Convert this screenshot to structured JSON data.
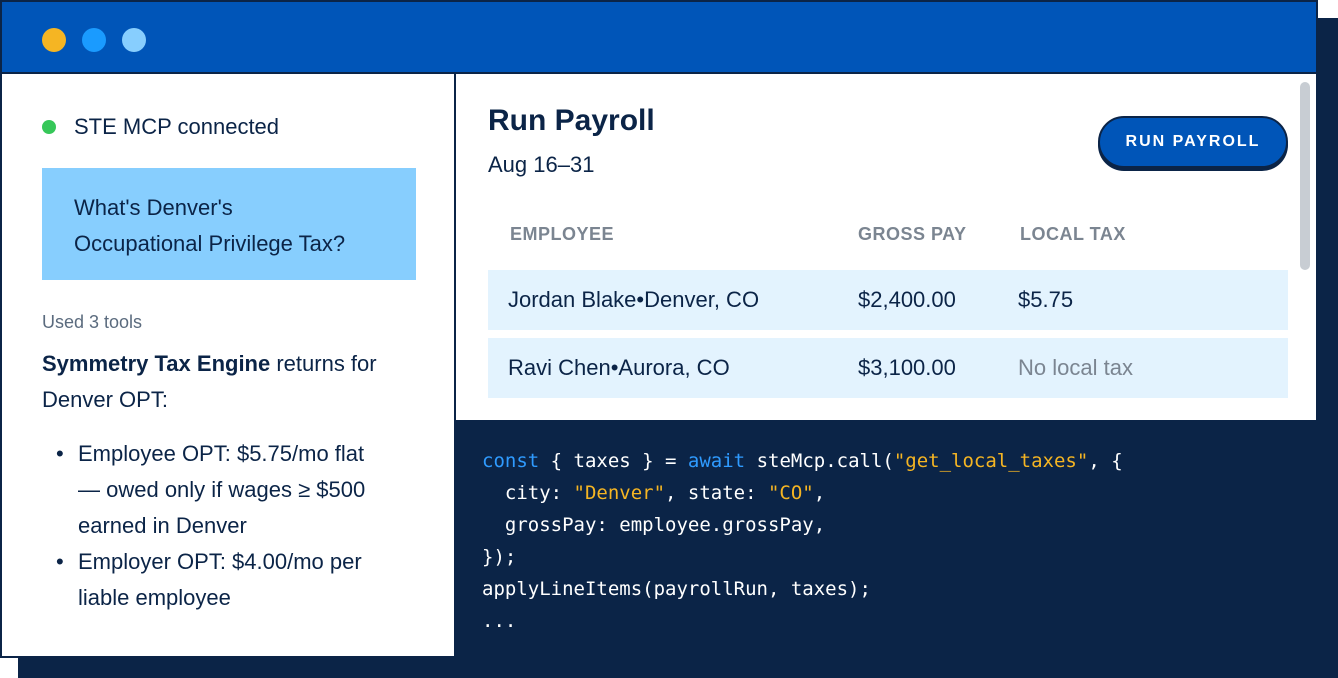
{
  "window": {
    "dots": [
      {
        "name": "window-dot-1",
        "color": "#f5b523"
      },
      {
        "name": "window-dot-2",
        "color": "#1a9bff"
      },
      {
        "name": "window-dot-3",
        "color": "#87cefe"
      }
    ]
  },
  "chat": {
    "status_text": "STE MCP connected",
    "status_color": "#36c759",
    "user_question_line1": "What's Denver's",
    "user_question_line2": "Occupational Privilege Tax?",
    "tools_used": "Used 3 tools",
    "answer_bold": "Symmetry Tax Engine",
    "answer_rest_1": " returns for",
    "answer_rest_2": "Denver OPT:",
    "bullets": [
      {
        "lines": [
          "Employee OPT: $5.75/mo flat",
          "— owed only if wages ≥ $500",
          "earned in Denver"
        ]
      },
      {
        "lines": [
          "Employer OPT: $4.00/mo per",
          "liable employee"
        ]
      }
    ]
  },
  "payroll": {
    "title": "Run Payroll",
    "period": "Aug 16–31",
    "run_button": "RUN PAYROLL",
    "columns": [
      "EMPLOYEE",
      "GROSS PAY",
      "LOCAL TAX"
    ],
    "rows": [
      {
        "name": "Jordan Blake",
        "location": "Denver, CO",
        "gross": "$2,400.00",
        "tax": "$5.75"
      },
      {
        "name": "Ravi Chen",
        "location": "Aurora, CO",
        "gross": "$3,100.00",
        "tax": "No local tax"
      }
    ],
    "separator": "•"
  },
  "code": {
    "l1_kw1": "const",
    "l1_a": " { taxes } = ",
    "l1_kw2": "await",
    "l1_b": " steMcp.call(",
    "l1_str": "\"get_local_taxes\"",
    "l1_c": ", {",
    "l2_a": "  city: ",
    "l2_str1": "\"Denver\"",
    "l2_b": ", state: ",
    "l2_str2": "\"CO\"",
    "l2_c": ",",
    "l3": "  grossPay: employee.grossPay,",
    "l4": "});",
    "l5": "applyLineItems(payrollRun, taxes);",
    "l6": "..."
  }
}
